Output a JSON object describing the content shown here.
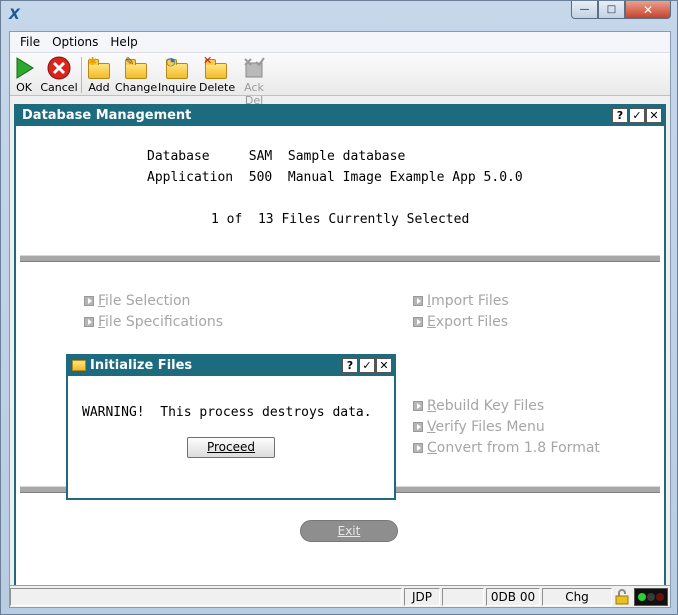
{
  "window": {
    "app_icon": "X",
    "min": "—",
    "max": "□",
    "close": "✕"
  },
  "menu": [
    "File",
    "Options",
    "Help"
  ],
  "toolbar": [
    {
      "label": "OK",
      "icon": "play-icon",
      "disabled": false
    },
    {
      "label": "Cancel",
      "icon": "cancel-icon",
      "disabled": false
    },
    {
      "label": "Add",
      "icon": "folder-add-icon",
      "disabled": false
    },
    {
      "label": "Change",
      "icon": "folder-edit-icon",
      "disabled": false
    },
    {
      "label": "Inquire",
      "icon": "folder-inquire-icon",
      "disabled": false
    },
    {
      "label": "Delete",
      "icon": "folder-delete-icon",
      "disabled": false
    },
    {
      "label": "Ack Del",
      "icon": "ack-delete-icon",
      "disabled": true
    }
  ],
  "panel": {
    "title": "Database Management",
    "help": "?",
    "ok": "✓",
    "close": "✕",
    "db_line": "Database     SAM  Sample database",
    "app_line": "Application  500  Manual Image Example App 5.0.0",
    "sel_line": "1 of  13 Files Currently Selected",
    "left_options": [
      {
        "hot": "F",
        "rest": "ile Selection"
      },
      {
        "hot": "F",
        "rest": "ile Specifications"
      }
    ],
    "right_options": [
      {
        "hot": "I",
        "rest": "mport Files"
      },
      {
        "hot": "E",
        "rest": "xport Files"
      },
      {
        "hot": "R",
        "rest": "ebuild Key Files"
      },
      {
        "hot": "V",
        "rest": "erify Files Menu"
      },
      {
        "hot": "C",
        "rest": "onvert from 1.8 Format"
      }
    ],
    "exit_label": "Exit"
  },
  "dialog": {
    "title": "Initialize Files",
    "help": "?",
    "ok": "✓",
    "close": "✕",
    "message": "WARNING!  This process destroys data.",
    "proceed_label": "Proceed"
  },
  "status": {
    "user": "JDP",
    "code": "0DB 00",
    "mode": "Chg"
  },
  "colors": {
    "title_bar": "#1c6b7e",
    "disabled_text": "#a6a6a6"
  }
}
